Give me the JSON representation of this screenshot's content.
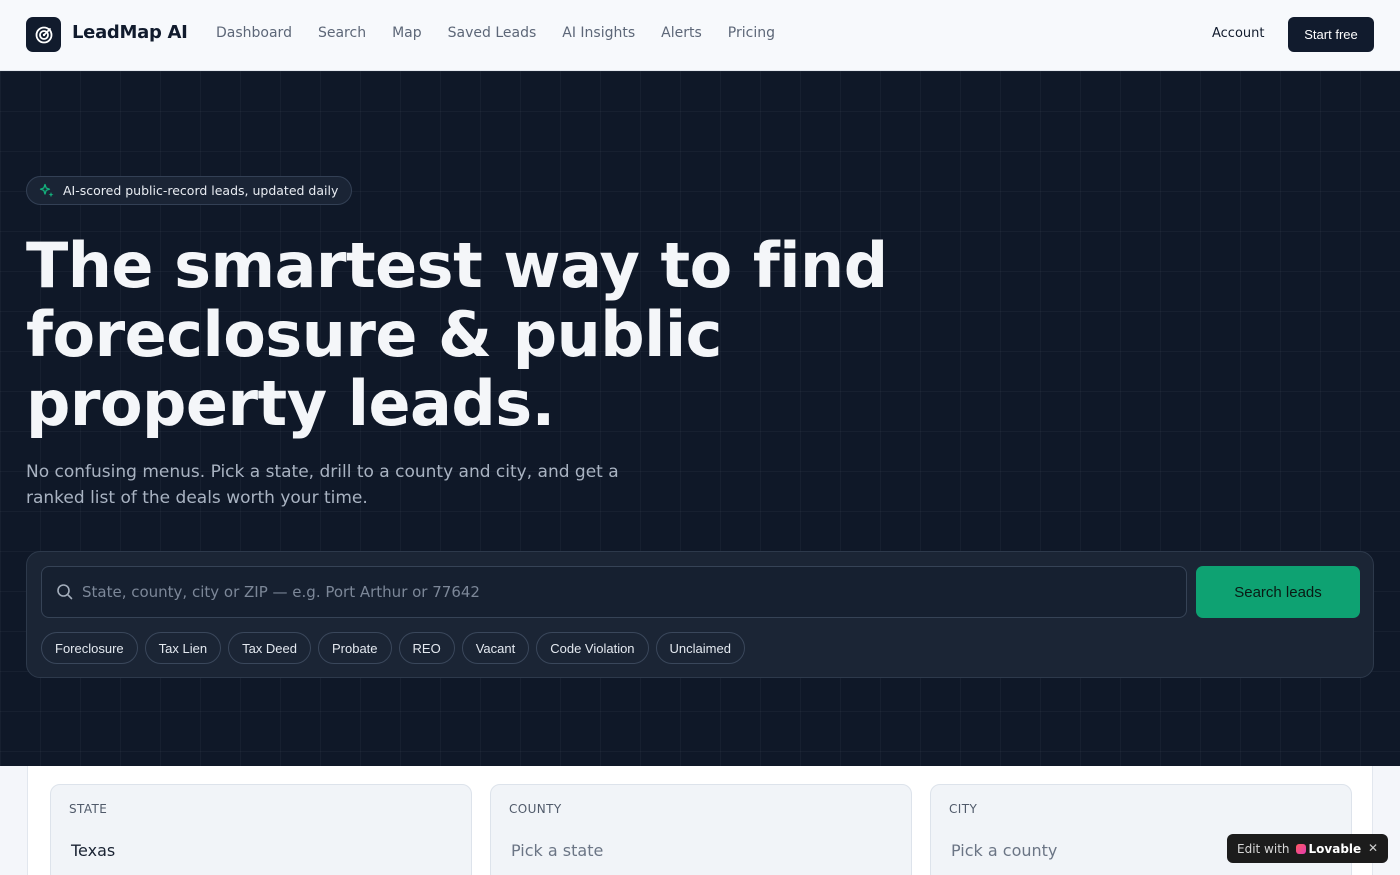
{
  "nav": {
    "brand": "LeadMap AI",
    "links": [
      "Dashboard",
      "Search",
      "Map",
      "Saved Leads",
      "AI Insights",
      "Alerts",
      "Pricing"
    ],
    "account_label": "Account",
    "start_label": "Start free"
  },
  "hero": {
    "badge": "AI-scored public-record leads, updated daily",
    "headline_lines": [
      "The smartest way to find",
      "foreclosure & public",
      "property leads."
    ],
    "subtitle": "No confusing menus. Pick a state, drill to a county and city, and get a ranked list of the deals worth your time."
  },
  "search": {
    "placeholder": "State, county, city or ZIP — e.g. Port Arthur or 77642",
    "value": "",
    "button_label": "Search leads",
    "chips": [
      "Foreclosure",
      "Tax Lien",
      "Tax Deed",
      "Probate",
      "REO",
      "Vacant",
      "Code Violation",
      "Unclaimed"
    ]
  },
  "selectors": {
    "state": {
      "label": "STATE",
      "value": "Texas"
    },
    "county": {
      "label": "COUNTY",
      "value": "Pick a state"
    },
    "city": {
      "label": "CITY",
      "value": "Pick a county"
    }
  },
  "lovable": {
    "prefix": "Edit with",
    "brand": "Lovable",
    "close": "✕"
  },
  "colors": {
    "accent": "#0ea272",
    "hero_bg": "#0f1828",
    "nav_bg": "#f7f9fc",
    "primary_dark": "#111b2d"
  }
}
